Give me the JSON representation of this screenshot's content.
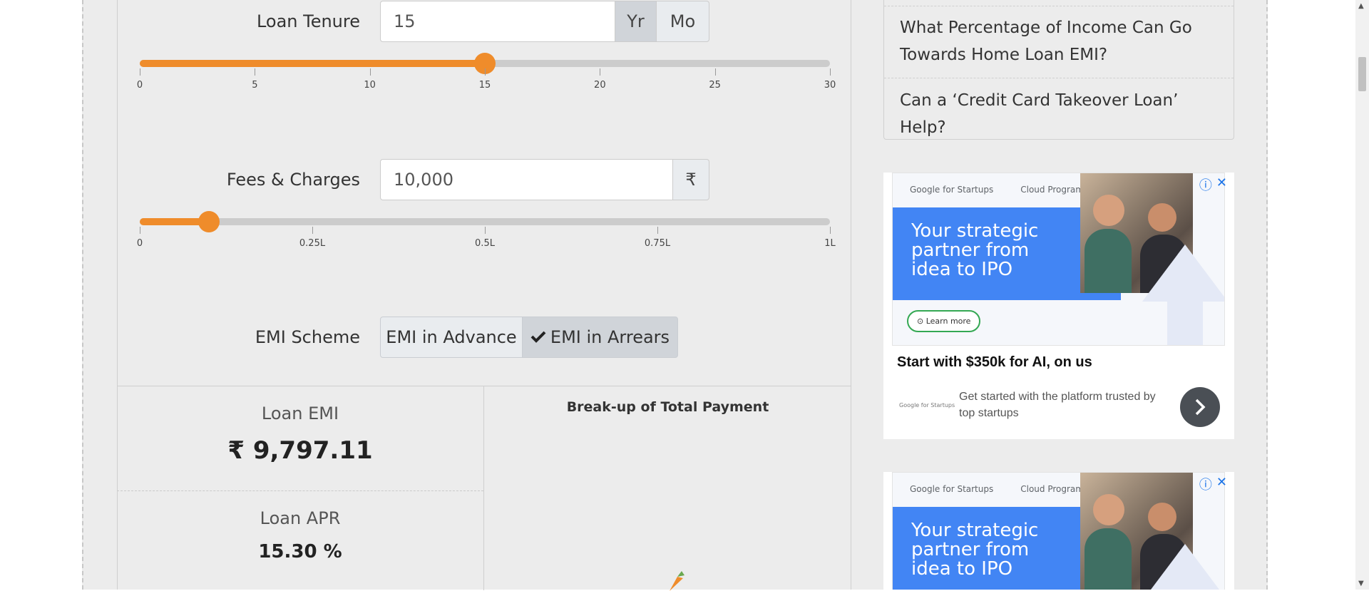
{
  "calculator": {
    "tenure": {
      "label": "Loan Tenure",
      "value": "15",
      "unit_year": "Yr",
      "unit_month": "Mo",
      "selected_unit": "Yr",
      "slider_fraction": 0.5,
      "ticks": [
        "0",
        "5",
        "10",
        "15",
        "20",
        "25",
        "30"
      ]
    },
    "fees": {
      "label": "Fees & Charges",
      "value": "10,000",
      "currency": "₹",
      "slider_fraction": 0.1,
      "ticks": [
        "0",
        "0.25L",
        "0.5L",
        "0.75L",
        "1L"
      ]
    },
    "scheme": {
      "label": "EMI Scheme",
      "option_advance": "EMI in Advance",
      "option_arrears": "EMI in Arrears",
      "selected": "EMI in Arrears"
    }
  },
  "results": {
    "emi_title": "Loan EMI",
    "emi_value": "₹ 9,797.11",
    "apr_title": "Loan APR",
    "apr_value": "15.30 %",
    "chart_title": "Break-up of Total Payment"
  },
  "sidebar": {
    "items": [
      "What Percentage of Income Can Go Towards Home Loan EMI?",
      "Can a ‘Credit Card Takeover Loan’ Help?"
    ]
  },
  "ads": [
    {
      "logo_left": "Google for Startups",
      "logo_right": "Cloud Program",
      "headline": "Your strategic partner from idea to IPO",
      "cta": "Learn more",
      "title": "Start with $350k for AI, on us",
      "small_logo": "Google for Startups",
      "description": "Get started with the platform trusted by top startups"
    },
    {
      "logo_left": "Google for Startups",
      "logo_right": "Cloud Program",
      "headline": "Your strategic partner from idea to IPO"
    }
  ],
  "colors": {
    "accent": "#ef8c2b",
    "panel": "#ececec",
    "ad_blue": "#4285f4"
  }
}
